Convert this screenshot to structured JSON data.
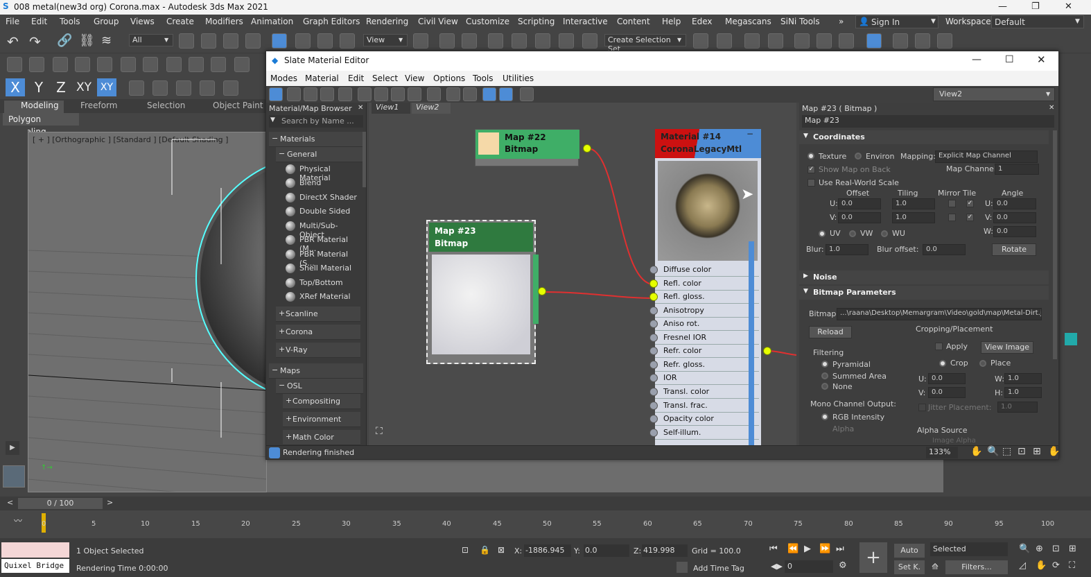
{
  "app": {
    "title": "008 metal(new3d org) Corona.max - Autodesk 3ds Max 2021",
    "menu": [
      "File",
      "Edit",
      "Tools",
      "Group",
      "Views",
      "Create",
      "Modifiers",
      "Animation",
      "Graph Editors",
      "Rendering",
      "Civil View",
      "Customize",
      "Scripting",
      "Interactive",
      "Content",
      "Help",
      "Edex",
      "Megascans",
      "SiNi Tools"
    ],
    "sign_in": "Sign In",
    "workspaces_label": "Workspaces:",
    "workspace_value": "Default",
    "toolbar": {
      "filter_value": "All",
      "refcoord_value": "View",
      "selection_set": "Create Selection Set",
      "axis_x": "X",
      "axis_y": "Y",
      "axis_z": "Z",
      "axis_xy": "XY",
      "axis_xy2": "XY"
    },
    "ribbon": [
      "Modeling",
      "Freeform",
      "Selection",
      "Object Paint"
    ],
    "ribbon_sub": "Polygon Modeling",
    "viewport_label": "[ + ] [Orthographic ] [Standard ] [Default Shading ]"
  },
  "slate": {
    "title": "Slate Material Editor",
    "menu": [
      "Modes",
      "Material",
      "Edit",
      "Select",
      "View",
      "Options",
      "Tools",
      "Utilities"
    ],
    "view_dropdown": "View2",
    "browser": {
      "title": "Material/Map Browser",
      "search_placeholder": "Search by Name ...",
      "materials_header": "Materials",
      "general_header": "General",
      "general_items": [
        "Physical Material",
        "Blend",
        "DirectX Shader",
        "Double Sided",
        "Multi/Sub-Object",
        "PBR Material (M...",
        "PBR Material (S...",
        "Shell Material",
        "Top/Bottom",
        "XRef Material"
      ],
      "categories": [
        "Scanline",
        "Corona",
        "V-Ray"
      ],
      "maps_header": "Maps",
      "osl_header": "OSL",
      "map_categories": [
        "Compositing",
        "Environment",
        "Math Color"
      ]
    },
    "tabs": [
      "View1",
      "View2"
    ],
    "nodes": {
      "map22_title": "Map #22",
      "map22_sub": "Bitmap",
      "map23_title": "Map #23",
      "map23_sub": "Bitmap",
      "mat_title": "Material #14",
      "mat_sub": "CoronaLegacyMtl",
      "slots": [
        "Diffuse color",
        "Refl. color",
        "Refl. gloss.",
        "Anisotropy",
        "Aniso rot.",
        "Fresnel IOR",
        "Refr. color",
        "Refr. gloss.",
        "IOR",
        "Transl. color",
        "Transl. frac.",
        "Opacity color",
        "Self-illum."
      ]
    },
    "props": {
      "header": "Map #23  ( Bitmap )",
      "name": "Map #23",
      "coordinates": "Coordinates",
      "texture": "Texture",
      "environ": "Environ",
      "mapping_label": "Mapping:",
      "mapping_value": "Explicit Map Channel",
      "show_map_on_back": "Show Map on Back",
      "map_channel_label": "Map Channel:",
      "map_channel_value": "1",
      "use_real_world": "Use Real-World Scale",
      "offset": "Offset",
      "tiling": "Tiling",
      "mirror_tile": "Mirror Tile",
      "angle": "Angle",
      "u_label": "U:",
      "v_label": "V:",
      "w_label": "W:",
      "u_offset": "0.0",
      "v_offset": "0.0",
      "u_tiling": "1.0",
      "v_tiling": "1.0",
      "u_angle": "0.0",
      "v_angle": "0.0",
      "w_angle": "0.0",
      "uv": "UV",
      "vw": "VW",
      "wu": "WU",
      "blur_label": "Blur:",
      "blur_value": "1.0",
      "blur_offset_label": "Blur offset:",
      "blur_offset_value": "0.0",
      "rotate": "Rotate",
      "noise": "Noise",
      "bitmap_params": "Bitmap Parameters",
      "bitmap_label": "Bitmap:",
      "bitmap_path": "...\\raana\\Desktop\\Memargram\\Video\\gold\\map\\Metal-Dirt.jpg",
      "reload": "Reload",
      "cropping": "Cropping/Placement",
      "apply": "Apply",
      "view_image": "View Image",
      "crop": "Crop",
      "place": "Place",
      "filtering": "Filtering",
      "pyramidal": "Pyramidal",
      "summed_area": "Summed Area",
      "none": "None",
      "crop_u": "0.0",
      "crop_v": "0.0",
      "crop_w": "1.0",
      "crop_h": "1.0",
      "h_label": "H:",
      "jitter": "Jitter Placement:",
      "jitter_value": "1.0",
      "mono_output": "Mono Channel Output:",
      "rgb_intensity": "RGB Intensity",
      "alpha": "Alpha",
      "alpha_source": "Alpha Source",
      "image_alpha": "Image Alpha"
    },
    "status": "Rendering finished",
    "zoom": "133%"
  },
  "timeline": {
    "frame": "0 / 100",
    "ticks": [
      "0",
      "5",
      "10",
      "15",
      "20",
      "25",
      "30",
      "35",
      "40",
      "45",
      "50",
      "55",
      "60",
      "65",
      "70",
      "75",
      "80",
      "85",
      "90",
      "95",
      "100"
    ]
  },
  "statusbar": {
    "objects": "1 Object Selected",
    "render_time": "Rendering Time  0:00:00",
    "quixel": "Quixel Bridge",
    "x_label": "X:",
    "x_value": "-1886.945",
    "y_label": "Y:",
    "y_value": "0.0",
    "z_label": "Z:",
    "z_value": "419.998",
    "grid": "Grid = 100.0",
    "add_time_tag": "Add Time Tag",
    "auto": "Auto",
    "selected": "Selected",
    "set_key": "Set K.",
    "filters": "Filters...",
    "frame_value": "0"
  },
  "colors": {
    "accent": "#4d8cd6",
    "node_green": "#2f7a3f",
    "node_map": "#3fae67",
    "material_red": "#cc1111",
    "socket_active": "#e6ff00",
    "wire": "#e03030"
  }
}
